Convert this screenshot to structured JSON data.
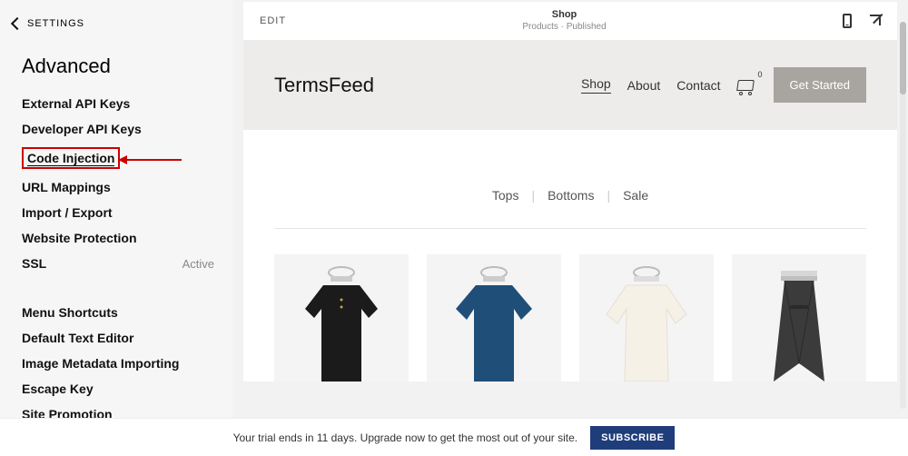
{
  "sidebar": {
    "back_label": "SETTINGS",
    "title": "Advanced",
    "group1": [
      "External API Keys",
      "Developer API Keys",
      "Code Injection",
      "URL Mappings",
      "Import / Export",
      "Website Protection"
    ],
    "ssl": {
      "label": "SSL",
      "status": "Active"
    },
    "group2": [
      "Menu Shortcuts",
      "Default Text Editor",
      "Image Metadata Importing",
      "Escape Key",
      "Site Promotion"
    ]
  },
  "preview": {
    "edit": "EDIT",
    "title": "Shop",
    "subtitle": "Products · Published",
    "brand": "TermsFeed",
    "nav": {
      "shop": "Shop",
      "about": "About",
      "contact": "Contact"
    },
    "cart_count": "0",
    "cta": "Get Started",
    "filters": {
      "tops": "Tops",
      "bottoms": "Bottoms",
      "sale": "Sale"
    }
  },
  "trial": {
    "text": "Your trial ends in 11 days. Upgrade now to get the most out of your site.",
    "button": "SUBSCRIBE"
  }
}
